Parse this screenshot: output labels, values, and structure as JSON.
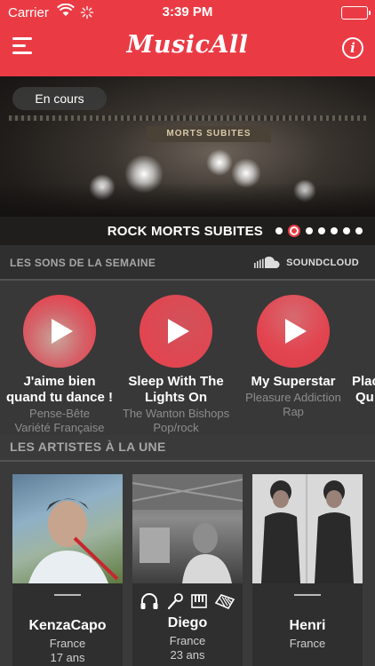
{
  "status_bar": {
    "carrier": "Carrier",
    "time": "3:39 PM"
  },
  "header": {
    "logo": "MusicAll"
  },
  "hero": {
    "pill_label": "En cours",
    "title": "ROCK MORTS SUBITES",
    "stage_sign": "MORTS SUBITES",
    "dots_count": 7,
    "active_dot": 1
  },
  "section_sounds": {
    "label": "LES SONS DE LA SEMAINE",
    "provider": "SOUNDCLOUD"
  },
  "tracks": [
    {
      "title_line1": "J'aime bien",
      "title_line2": "quand tu dance !",
      "artist": "Pense-Bête",
      "genre": "Variété Française"
    },
    {
      "title_line1": "Sleep With The",
      "title_line2": "Lights On",
      "artist": "The Wanton Bishops",
      "genre": "Pop/rock"
    },
    {
      "title_line1": "My Superstar",
      "title_line2": "",
      "artist": "Pleasure Addiction",
      "genre": "Rap"
    },
    {
      "title_line1": "Plac",
      "title_line2": "Qu",
      "artist": "",
      "genre": ""
    }
  ],
  "section_artists": {
    "label": "LES ARTISTES À LA UNE"
  },
  "artists": [
    {
      "name": "KenzaCapo",
      "country": "France",
      "age": "17 ans",
      "instruments": []
    },
    {
      "name": "Diego",
      "country": "France",
      "age": "23 ans",
      "instruments": [
        "headphones-icon",
        "microphone-icon",
        "keyboard-icon",
        "accordion-icon"
      ]
    },
    {
      "name": "Henri",
      "country": "France",
      "age": "",
      "instruments": []
    }
  ],
  "colors": {
    "brand": "#ea3b45",
    "background": "#3a3a3a",
    "section_header": "#2f2f2f"
  }
}
